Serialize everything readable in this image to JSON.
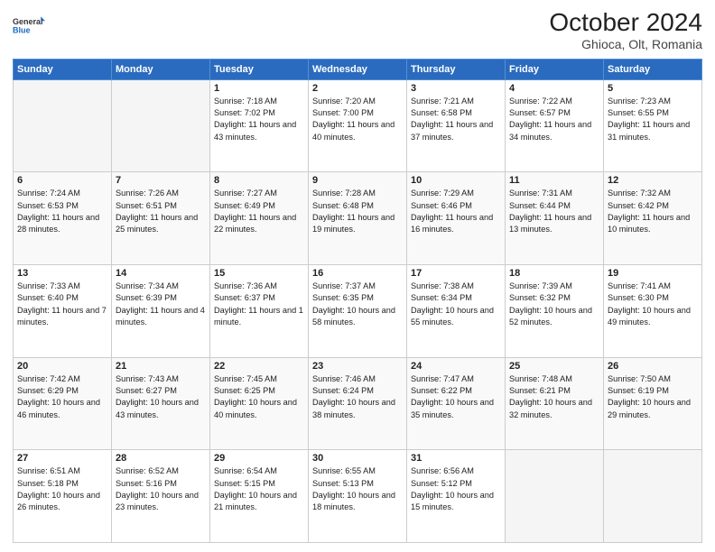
{
  "header": {
    "logo_line1": "General",
    "logo_line2": "Blue",
    "title": "October 2024",
    "subtitle": "Ghioca, Olt, Romania"
  },
  "weekdays": [
    "Sunday",
    "Monday",
    "Tuesday",
    "Wednesday",
    "Thursday",
    "Friday",
    "Saturday"
  ],
  "weeks": [
    [
      {
        "day": "",
        "info": ""
      },
      {
        "day": "",
        "info": ""
      },
      {
        "day": "1",
        "info": "Sunrise: 7:18 AM\nSunset: 7:02 PM\nDaylight: 11 hours and 43 minutes."
      },
      {
        "day": "2",
        "info": "Sunrise: 7:20 AM\nSunset: 7:00 PM\nDaylight: 11 hours and 40 minutes."
      },
      {
        "day": "3",
        "info": "Sunrise: 7:21 AM\nSunset: 6:58 PM\nDaylight: 11 hours and 37 minutes."
      },
      {
        "day": "4",
        "info": "Sunrise: 7:22 AM\nSunset: 6:57 PM\nDaylight: 11 hours and 34 minutes."
      },
      {
        "day": "5",
        "info": "Sunrise: 7:23 AM\nSunset: 6:55 PM\nDaylight: 11 hours and 31 minutes."
      }
    ],
    [
      {
        "day": "6",
        "info": "Sunrise: 7:24 AM\nSunset: 6:53 PM\nDaylight: 11 hours and 28 minutes."
      },
      {
        "day": "7",
        "info": "Sunrise: 7:26 AM\nSunset: 6:51 PM\nDaylight: 11 hours and 25 minutes."
      },
      {
        "day": "8",
        "info": "Sunrise: 7:27 AM\nSunset: 6:49 PM\nDaylight: 11 hours and 22 minutes."
      },
      {
        "day": "9",
        "info": "Sunrise: 7:28 AM\nSunset: 6:48 PM\nDaylight: 11 hours and 19 minutes."
      },
      {
        "day": "10",
        "info": "Sunrise: 7:29 AM\nSunset: 6:46 PM\nDaylight: 11 hours and 16 minutes."
      },
      {
        "day": "11",
        "info": "Sunrise: 7:31 AM\nSunset: 6:44 PM\nDaylight: 11 hours and 13 minutes."
      },
      {
        "day": "12",
        "info": "Sunrise: 7:32 AM\nSunset: 6:42 PM\nDaylight: 11 hours and 10 minutes."
      }
    ],
    [
      {
        "day": "13",
        "info": "Sunrise: 7:33 AM\nSunset: 6:40 PM\nDaylight: 11 hours and 7 minutes."
      },
      {
        "day": "14",
        "info": "Sunrise: 7:34 AM\nSunset: 6:39 PM\nDaylight: 11 hours and 4 minutes."
      },
      {
        "day": "15",
        "info": "Sunrise: 7:36 AM\nSunset: 6:37 PM\nDaylight: 11 hours and 1 minute."
      },
      {
        "day": "16",
        "info": "Sunrise: 7:37 AM\nSunset: 6:35 PM\nDaylight: 10 hours and 58 minutes."
      },
      {
        "day": "17",
        "info": "Sunrise: 7:38 AM\nSunset: 6:34 PM\nDaylight: 10 hours and 55 minutes."
      },
      {
        "day": "18",
        "info": "Sunrise: 7:39 AM\nSunset: 6:32 PM\nDaylight: 10 hours and 52 minutes."
      },
      {
        "day": "19",
        "info": "Sunrise: 7:41 AM\nSunset: 6:30 PM\nDaylight: 10 hours and 49 minutes."
      }
    ],
    [
      {
        "day": "20",
        "info": "Sunrise: 7:42 AM\nSunset: 6:29 PM\nDaylight: 10 hours and 46 minutes."
      },
      {
        "day": "21",
        "info": "Sunrise: 7:43 AM\nSunset: 6:27 PM\nDaylight: 10 hours and 43 minutes."
      },
      {
        "day": "22",
        "info": "Sunrise: 7:45 AM\nSunset: 6:25 PM\nDaylight: 10 hours and 40 minutes."
      },
      {
        "day": "23",
        "info": "Sunrise: 7:46 AM\nSunset: 6:24 PM\nDaylight: 10 hours and 38 minutes."
      },
      {
        "day": "24",
        "info": "Sunrise: 7:47 AM\nSunset: 6:22 PM\nDaylight: 10 hours and 35 minutes."
      },
      {
        "day": "25",
        "info": "Sunrise: 7:48 AM\nSunset: 6:21 PM\nDaylight: 10 hours and 32 minutes."
      },
      {
        "day": "26",
        "info": "Sunrise: 7:50 AM\nSunset: 6:19 PM\nDaylight: 10 hours and 29 minutes."
      }
    ],
    [
      {
        "day": "27",
        "info": "Sunrise: 6:51 AM\nSunset: 5:18 PM\nDaylight: 10 hours and 26 minutes."
      },
      {
        "day": "28",
        "info": "Sunrise: 6:52 AM\nSunset: 5:16 PM\nDaylight: 10 hours and 23 minutes."
      },
      {
        "day": "29",
        "info": "Sunrise: 6:54 AM\nSunset: 5:15 PM\nDaylight: 10 hours and 21 minutes."
      },
      {
        "day": "30",
        "info": "Sunrise: 6:55 AM\nSunset: 5:13 PM\nDaylight: 10 hours and 18 minutes."
      },
      {
        "day": "31",
        "info": "Sunrise: 6:56 AM\nSunset: 5:12 PM\nDaylight: 10 hours and 15 minutes."
      },
      {
        "day": "",
        "info": ""
      },
      {
        "day": "",
        "info": ""
      }
    ]
  ]
}
